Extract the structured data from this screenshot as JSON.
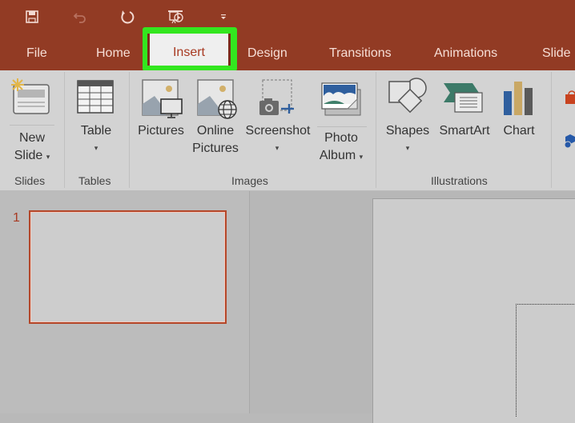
{
  "quick_access": {
    "items": [
      {
        "name": "save-icon"
      },
      {
        "name": "undo-icon"
      },
      {
        "name": "redo-icon"
      },
      {
        "name": "start-from-beginning-icon"
      },
      {
        "name": "customize-toolbar-icon"
      }
    ]
  },
  "tabs": [
    {
      "label": "File"
    },
    {
      "label": "Home"
    },
    {
      "label": "Insert",
      "active": true
    },
    {
      "label": "Design"
    },
    {
      "label": "Transitions"
    },
    {
      "label": "Animations"
    },
    {
      "label": "Slide"
    }
  ],
  "ribbon": {
    "groups": [
      {
        "label": "Slides",
        "commands": [
          {
            "line1": "New",
            "line2": "Slide",
            "caret": "▾"
          }
        ]
      },
      {
        "label": "Tables",
        "commands": [
          {
            "line1": "Table",
            "caret": "▾"
          }
        ]
      },
      {
        "label": "Images",
        "commands": [
          {
            "line1": "Pictures"
          },
          {
            "line1": "Online",
            "line2": "Pictures"
          },
          {
            "line1": "Screenshot",
            "caret": "▾"
          },
          {
            "line1": "Photo",
            "line2": "Album",
            "caret": "▾"
          }
        ]
      },
      {
        "label": "Illustrations",
        "commands": [
          {
            "line1": "Shapes",
            "caret": "▾"
          },
          {
            "line1": "SmartArt"
          },
          {
            "line1": "Chart"
          }
        ]
      }
    ]
  },
  "slides_panel": {
    "slides": [
      {
        "number": "1"
      }
    ]
  },
  "colors": {
    "title_bar": "#923b24",
    "highlight": "#33e61f",
    "accent": "#a83a22"
  }
}
